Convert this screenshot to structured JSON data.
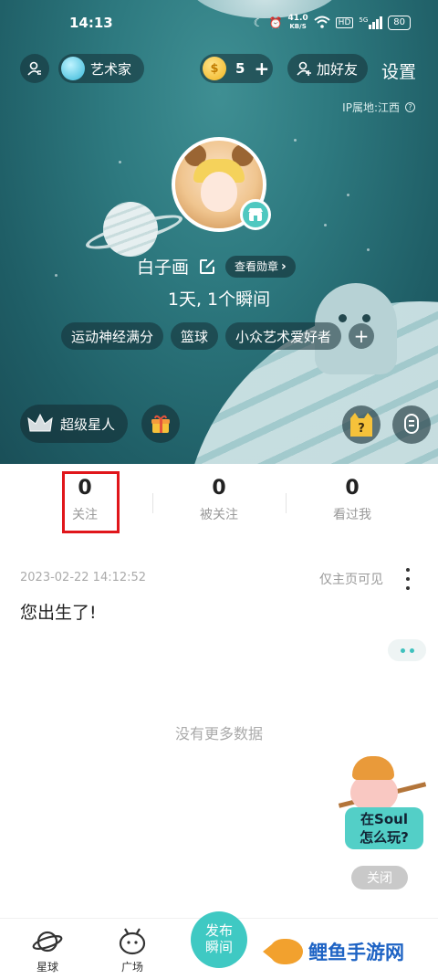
{
  "status_bar": {
    "time": "14:13",
    "net_speed": "41.0",
    "net_unit": "KB/S",
    "hd": "HD",
    "signal": "5G",
    "battery": "80"
  },
  "header": {
    "profile_icon": "person-icon",
    "role_badge": "艺术家",
    "coins": "5",
    "coins_plus": "+",
    "add_friend": "加好友",
    "settings": "设置",
    "ip_location": "IP属地:江西",
    "help_mark": "?"
  },
  "profile": {
    "name": "白子画",
    "medal_button": "查看勋章",
    "medal_chevron": "›",
    "summary": "1天, 1个瞬间",
    "tags": [
      "运动神经满分",
      "篮球",
      "小众艺术爱好者"
    ],
    "tag_add": "+",
    "superstar": "超级星人"
  },
  "stats": [
    {
      "num": "0",
      "label": "关注"
    },
    {
      "num": "0",
      "label": "被关注"
    },
    {
      "num": "0",
      "label": "看过我"
    }
  ],
  "post": {
    "date": "2023-02-22 14:12:52",
    "privacy": "仅主页可见",
    "text": "您出生了!"
  },
  "feed": {
    "no_more": "没有更多数据"
  },
  "mascot": {
    "line1": "在Soul",
    "line2": "怎么玩?",
    "close": "关闭"
  },
  "bottom_nav": {
    "planet": "星球",
    "square": "广场",
    "publish_line1": "发布",
    "publish_line2": "瞬间"
  },
  "watermark": {
    "text": "鲤鱼手游网"
  },
  "colors": {
    "accent": "#3fc9c3",
    "highlight": "#e0161b",
    "header_bg": "#2e7a80"
  }
}
